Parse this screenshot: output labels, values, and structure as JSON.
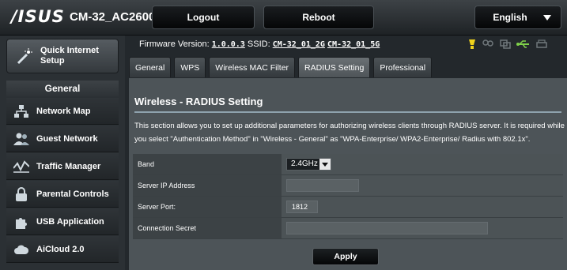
{
  "header": {
    "brand": "/ISUS",
    "model": "CM-32_AC2600",
    "logout_label": "Logout",
    "reboot_label": "Reboot",
    "language": "English"
  },
  "sidebar": {
    "quick_setup_label": "Quick Internet Setup",
    "section_title": "General",
    "items": [
      {
        "label": "Network Map",
        "icon": "network-map-icon"
      },
      {
        "label": "Guest Network",
        "icon": "guest-network-icon"
      },
      {
        "label": "Traffic Manager",
        "icon": "traffic-manager-icon"
      },
      {
        "label": "Parental Controls",
        "icon": "lock-icon"
      },
      {
        "label": "USB Application",
        "icon": "puzzle-icon"
      },
      {
        "label": "AiCloud 2.0",
        "icon": "cloud-icon"
      }
    ]
  },
  "info": {
    "firmware_label": "Firmware Version:",
    "firmware_value": "1.0.0.3",
    "ssid_label": "SSID:",
    "ssid_2g": "CM-32_01_2G",
    "ssid_5g": "CM-32_01_5G"
  },
  "tabs": [
    {
      "label": "General",
      "active": false
    },
    {
      "label": "WPS",
      "active": false
    },
    {
      "label": "Wireless MAC Filter",
      "active": false
    },
    {
      "label": "RADIUS Setting",
      "active": true
    },
    {
      "label": "Professional",
      "active": false
    }
  ],
  "panel": {
    "title": "Wireless - RADIUS Setting",
    "description": "This section allows you to set up additional parameters for authorizing wireless clients through RADIUS server. It is required while you select \"Authentication Method\" in \"Wireless - General\" as \"WPA-Enterprise/ WPA2-Enterprise/ Radius with 802.1x\".",
    "fields": {
      "band_label": "Band",
      "band_value": "2.4GHz",
      "server_ip_label": "Server IP Address",
      "server_ip_value": "",
      "server_port_label": "Server Port:",
      "server_port_value": "1812",
      "secret_label": "Connection Secret",
      "secret_value": ""
    },
    "apply_label": "Apply"
  },
  "colors": {
    "panel_bg": "#4d5458",
    "label_bg": "#3c4245",
    "usb_status": "#7fd14a",
    "internet_status": "#f0d21c"
  }
}
